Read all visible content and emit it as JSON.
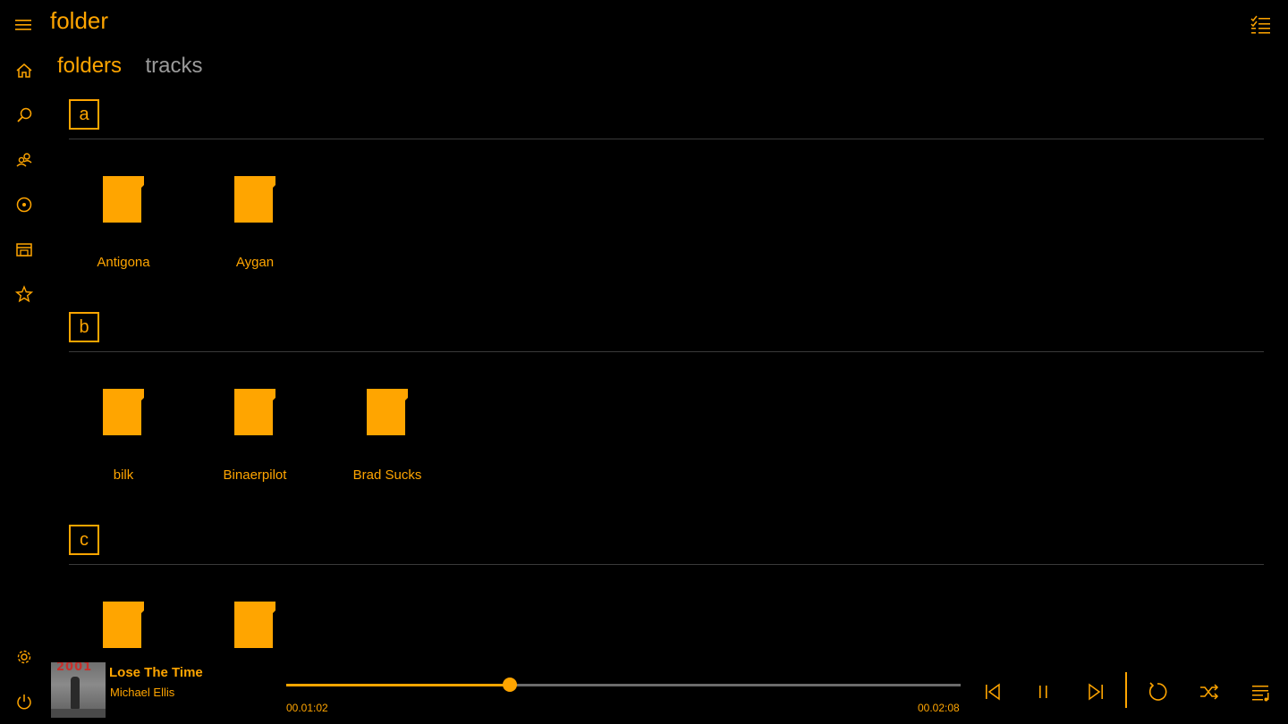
{
  "header": {
    "title": "folder",
    "menu_icon": "hamburger-icon",
    "select_icon": "multi-select-icon"
  },
  "sidebar": {
    "items": [
      {
        "name": "home",
        "icon": "home-icon"
      },
      {
        "name": "search",
        "icon": "search-icon"
      },
      {
        "name": "artists",
        "icon": "people-icon"
      },
      {
        "name": "albums",
        "icon": "disc-icon"
      },
      {
        "name": "folders",
        "icon": "folder-library-icon"
      },
      {
        "name": "favorites",
        "icon": "star-icon"
      },
      {
        "name": "settings",
        "icon": "gear-icon"
      },
      {
        "name": "power",
        "icon": "power-icon"
      }
    ]
  },
  "pivot": {
    "tabs": [
      {
        "label": "folders",
        "active": true
      },
      {
        "label": "tracks",
        "active": false
      }
    ]
  },
  "groups": [
    {
      "letter": "a",
      "folders": [
        "Antigona",
        "Aygan"
      ]
    },
    {
      "letter": "b",
      "folders": [
        "bilk",
        "Binaerpilot",
        "Brad Sucks"
      ]
    },
    {
      "letter": "c",
      "folders": [
        "",
        ""
      ]
    }
  ],
  "player": {
    "album_art_text": "2001",
    "title": "Lose The Time",
    "artist": "Michael Ellis",
    "current_time": "00.01:02",
    "total_time": "00.02:08",
    "progress": 0.331,
    "controls": [
      "previous-icon",
      "pause-icon",
      "next-icon",
      "repeat-icon",
      "shuffle-icon",
      "playlist-icon"
    ]
  },
  "colors": {
    "accent": "#ffa500",
    "background": "#000000",
    "inactive_tab": "#9a9a9a",
    "divider": "#3a3a3a"
  }
}
